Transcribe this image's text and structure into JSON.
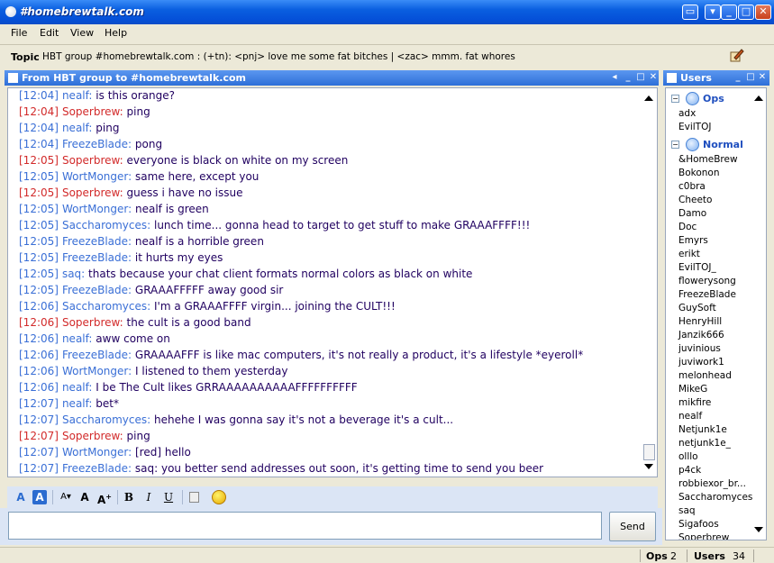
{
  "window": {
    "title": "#homebrewtalk.com"
  },
  "menu": {
    "items": [
      "File",
      "Edit",
      "View",
      "Help"
    ]
  },
  "topic": {
    "label": "Topic",
    "text": "HBT group #homebrewtalk.com : (+tn): <pnj> love me some fat bitches | <zac> mmm. fat whores"
  },
  "chat": {
    "header": "From HBT group to #homebrewtalk.com",
    "messages": [
      {
        "time": "[12:04]",
        "nick": "nealf:",
        "text": "is this orange?",
        "color": "blue"
      },
      {
        "time": "[12:04]",
        "nick": "Soperbrew:",
        "text": "ping",
        "color": "red"
      },
      {
        "time": "[12:04]",
        "nick": "nealf:",
        "text": "ping",
        "color": "blue"
      },
      {
        "time": "[12:04]",
        "nick": "FreezeBlade:",
        "text": "pong",
        "color": "blue"
      },
      {
        "time": "[12:05]",
        "nick": "Soperbrew:",
        "text": "everyone is black on white on my screen",
        "color": "red"
      },
      {
        "time": "[12:05]",
        "nick": "WortMonger:",
        "text": "same here, except you",
        "color": "blue"
      },
      {
        "time": "[12:05]",
        "nick": "Soperbrew:",
        "text": "guess i have no issue",
        "color": "red"
      },
      {
        "time": "[12:05]",
        "nick": "WortMonger:",
        "text": "nealf is green",
        "color": "blue"
      },
      {
        "time": "[12:05]",
        "nick": "Saccharomyces:",
        "text": "lunch time... gonna head to target to get stuff to make GRAAAFFFF!!!",
        "color": "blue"
      },
      {
        "time": "[12:05]",
        "nick": "FreezeBlade:",
        "text": "nealf is a horrible green",
        "color": "blue"
      },
      {
        "time": "[12:05]",
        "nick": "FreezeBlade:",
        "text": "it hurts my eyes",
        "color": "blue"
      },
      {
        "time": "[12:05]",
        "nick": "saq:",
        "text": "thats because your chat client formats normal colors as black on white",
        "color": "blue"
      },
      {
        "time": "[12:05]",
        "nick": "FreezeBlade:",
        "text": "GRAAAFFFFF away good sir",
        "color": "blue"
      },
      {
        "time": "[12:06]",
        "nick": "Saccharomyces:",
        "text": "I'm a GRAAAFFFF virgin... joining the CULT!!!",
        "color": "blue"
      },
      {
        "time": "[12:06]",
        "nick": "Soperbrew:",
        "text": "the cult is a good band",
        "color": "red"
      },
      {
        "time": "[12:06]",
        "nick": "nealf:",
        "text": "aww come on",
        "color": "blue"
      },
      {
        "time": "[12:06]",
        "nick": "FreezeBlade:",
        "text": "GRAAAAFFF is like mac computers, it's not really a product, it's a lifestyle *eyeroll*",
        "color": "blue"
      },
      {
        "time": "[12:06]",
        "nick": "WortMonger:",
        "text": "I listened to them yesterday",
        "color": "blue"
      },
      {
        "time": "[12:06]",
        "nick": "nealf:",
        "text": "I be The Cult likes GRRAAAAAAAAAAFFFFFFFFFF",
        "color": "blue"
      },
      {
        "time": "[12:07]",
        "nick": "nealf:",
        "text": "bet*",
        "color": "blue"
      },
      {
        "time": "[12:07]",
        "nick": "Saccharomyces:",
        "text": "hehehe I was gonna say it's not a beverage it's a cult...",
        "color": "blue"
      },
      {
        "time": "[12:07]",
        "nick": "Soperbrew:",
        "text": "ping",
        "color": "red"
      },
      {
        "time": "[12:07]",
        "nick": "WortMonger:",
        "text": "[red] hello",
        "color": "blue"
      },
      {
        "time": "[12:07]",
        "nick": "FreezeBlade:",
        "text": "saq: you better send addresses out soon, it's getting time to send you beer",
        "color": "blue"
      }
    ]
  },
  "composer": {
    "value": "",
    "send_label": "Send"
  },
  "users": {
    "header": "Users",
    "ops_label": "Ops",
    "normal_label": "Normal",
    "ops": [
      "adx",
      "EvilTOJ"
    ],
    "normal": [
      "&HomeBrew",
      "Bokonon",
      "c0bra",
      "Cheeto",
      "Damo",
      "Doc",
      "Emyrs",
      "erikt",
      "EvilTOJ_",
      "flowerysong",
      "FreezeBlade",
      "GuySoft",
      "HenryHill",
      "Janzik666",
      "juvinious",
      "juviwork1",
      "melonhead",
      "MikeG",
      "mikfire",
      "nealf",
      "Netjunk1e",
      "netjunk1e_",
      "olllo",
      "p4ck",
      "robbiexor_br...",
      "Saccharomyces",
      "saq",
      "Sigafoos",
      "Soperbrew"
    ]
  },
  "status": {
    "ops_label": "Ops",
    "ops_count": "2",
    "users_label": "Users",
    "users_count": "34"
  },
  "colors": {
    "nick_blue": "#3a6fd6",
    "nick_red": "#d22a2a",
    "message": "#200060",
    "pane_header": "#2e6fd8"
  }
}
